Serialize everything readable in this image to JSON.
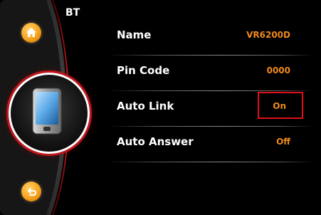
{
  "screen": {
    "title": "BT"
  },
  "nav": {
    "home_icon": "home-icon",
    "back_icon": "back-arrow-icon",
    "device_icon": "smartphone-icon",
    "accent_color": "#f6a21c",
    "ring_color": "#c0161d"
  },
  "settings": [
    {
      "label": "Name",
      "value": "VR6200D"
    },
    {
      "label": "Pin Code",
      "value": "0000"
    },
    {
      "label": "Auto Link",
      "value": "On"
    },
    {
      "label": "Auto Answer",
      "value": "Off"
    }
  ],
  "value_color": "#f08a1e",
  "highlight_color": "#e0101a"
}
